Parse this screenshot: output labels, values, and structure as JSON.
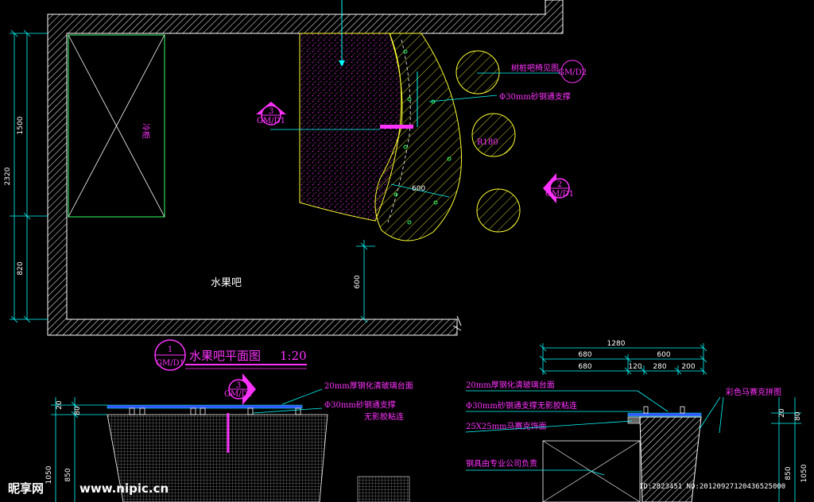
{
  "plan": {
    "title_prefix": "水果吧平面图",
    "title_scale": "1:20",
    "section_tag": {
      "number": "1",
      "ref": "GM/D1"
    },
    "room_label": "水果吧",
    "fridge_label": "冷柜",
    "callout_stool": "树桩吧椅见图",
    "callout_stool_ref": "GM/D2",
    "callout_pipe": "Φ30mm砂钢通支撑",
    "radius_label": "R180",
    "width_label": "600",
    "marker_3": {
      "number": "3",
      "ref": "GM/D1"
    },
    "marker_2": {
      "number": "2",
      "ref": "GM/D1"
    },
    "dims_left": [
      "2320",
      "1500",
      "820"
    ],
    "dim_600_vertical": "600"
  },
  "section_left": {
    "marker_3": {
      "number": "3",
      "ref": "GM/D1"
    },
    "note_glass": "20mm厚钢化清玻璃台面",
    "note_pipe_1": "Φ30mm砂钢通支撑",
    "note_pipe_2": "无影胶粘连",
    "dims": [
      "20",
      "80",
      "1050",
      "850"
    ]
  },
  "section_right": {
    "dims_top": [
      "1280",
      "680",
      "600",
      "680",
      "120",
      "280",
      "200"
    ],
    "note_glass": "20mm厚钢化清玻璃台面",
    "note_pipe": "Φ30mm砂钢通支撑无影胶粘连",
    "note_mosaic": "25X25mm马赛克饰面",
    "note_vendor": "钢具由专业公司负责",
    "note_color_mosaic": "彩色马赛克拼图",
    "dims_side": [
      "20",
      "80",
      "850",
      "1050"
    ]
  },
  "watermark": {
    "brand": "昵享网",
    "site": "www.nipic.cn",
    "id_text": "ID:2823451 NO:20120927120436525000"
  },
  "colors": {
    "background": "#000000",
    "wall": "#ffffff",
    "dimension": "#00ffff",
    "annotation": "#ff33ff",
    "counter": "#ffff33",
    "fridge": "#33ff66"
  }
}
